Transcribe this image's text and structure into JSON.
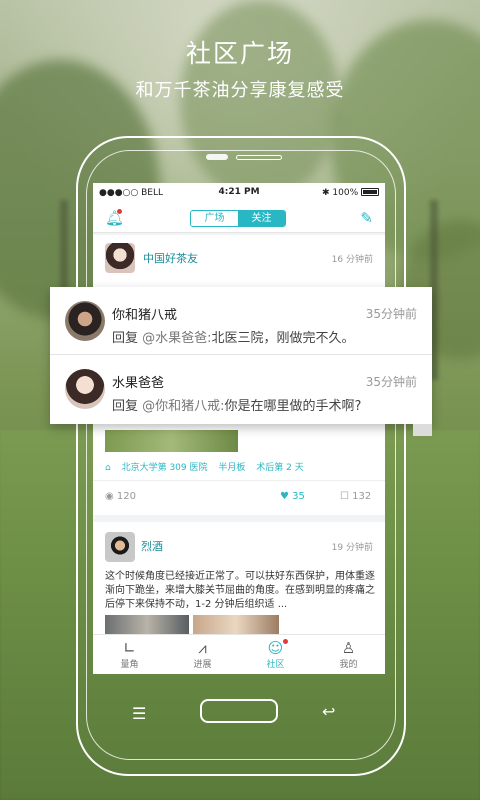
{
  "hero": {
    "title": "社区广场",
    "subtitle": "和万千茶油分享康复感受"
  },
  "status_bar": {
    "carrier": "●●●○○ BELL",
    "time": "4:21 PM",
    "battery": "100%"
  },
  "nav": {
    "tabs": [
      "广场",
      "关注"
    ],
    "active_tab": "关注",
    "bell_icon": "bell-icon",
    "edit_icon": "edit-icon"
  },
  "feed": {
    "card1": {
      "author": "中国好茶友",
      "time": "16 分钟前",
      "tags": [
        "北京大学第 309 医院",
        "半月板",
        "术后第 2 天"
      ],
      "views": "120",
      "likes": "35",
      "comments": "132"
    },
    "card2": {
      "author": "烈酒",
      "time": "19 分钟前",
      "body": "这个时候角度已经接近正常了。可以扶好东西保护，用体重逐渐向下跪坐，来增大膝关节屈曲的角度。在感到明显的疼痛之后停下来保持不动，1-2 分钟后组织适 ..."
    }
  },
  "popup": {
    "replies": [
      {
        "author": "你和猪八戒",
        "time": "35分钟前",
        "prefix": "回复",
        "mention": "@水果爸爸:",
        "text": "北医三院，刚做完不久。"
      },
      {
        "author": "水果爸爸",
        "time": "35分钟前",
        "prefix": "回复",
        "mention": "@你和猪八戒:",
        "text": "你是在哪里做的手术啊?"
      }
    ]
  },
  "tabbar": {
    "items": [
      {
        "label": "量角",
        "icon": "protractor-icon"
      },
      {
        "label": "进展",
        "icon": "chart-icon"
      },
      {
        "label": "社区",
        "icon": "community-icon"
      },
      {
        "label": "我的",
        "icon": "profile-icon"
      }
    ],
    "active": "社区"
  },
  "colors": {
    "accent": "#29b7c4",
    "badge": "#e53935"
  }
}
